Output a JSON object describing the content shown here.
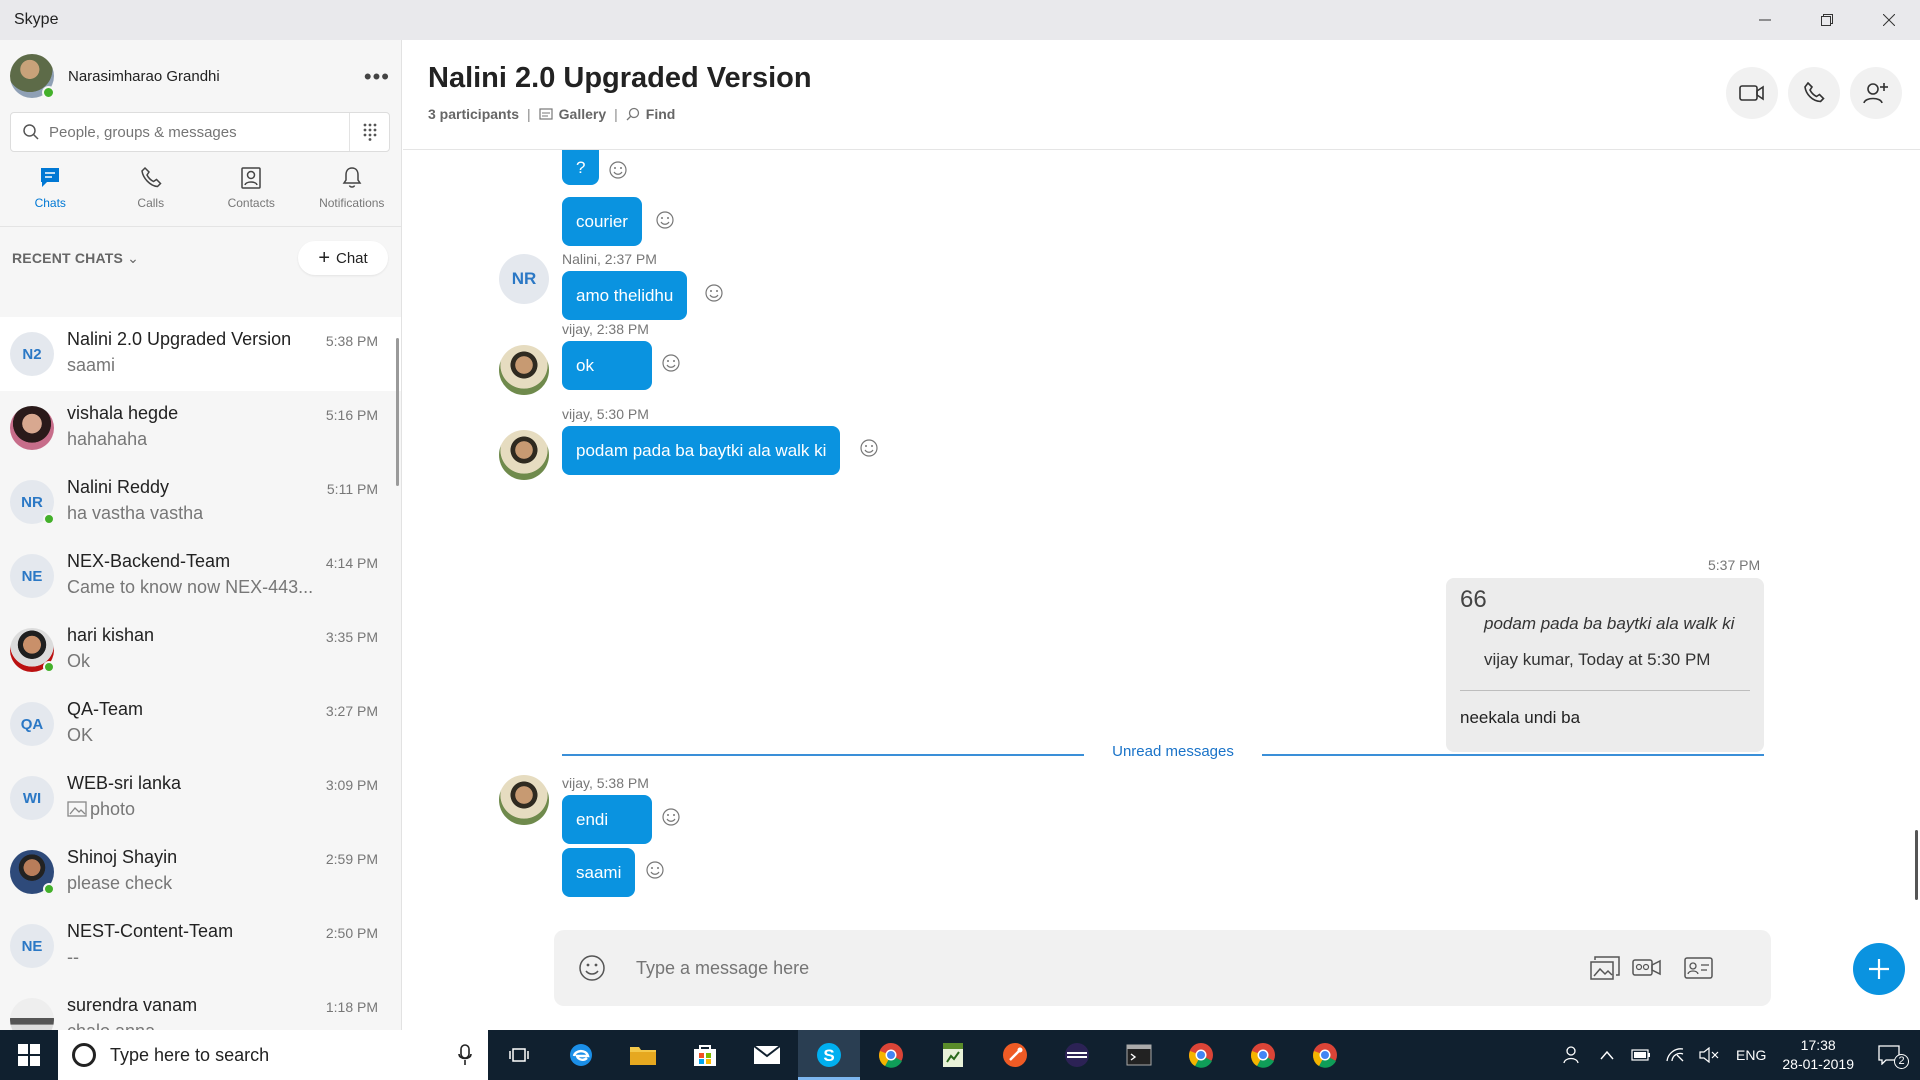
{
  "window": {
    "title": "Skype"
  },
  "profile": {
    "name": "Narasimharao Grandhi"
  },
  "search": {
    "placeholder": "People, groups & messages"
  },
  "nav": {
    "tabs": [
      {
        "label": "Chats"
      },
      {
        "label": "Calls"
      },
      {
        "label": "Contacts"
      },
      {
        "label": "Notifications"
      }
    ]
  },
  "recent": {
    "label": "RECENT CHATS",
    "new_chat_label": "Chat"
  },
  "chats": [
    {
      "title": "Nalini 2.0 Upgraded Version",
      "preview": "saami",
      "time": "5:38 PM",
      "initials": "N2",
      "online": false,
      "active": true
    },
    {
      "title": "vishala hegde",
      "preview": "hahahaha",
      "time": "5:16 PM",
      "initials": "",
      "online": false,
      "active": false
    },
    {
      "title": "Nalini Reddy",
      "preview": "ha vastha vastha",
      "time": "5:11 PM",
      "initials": "NR",
      "online": true,
      "active": false
    },
    {
      "title": "NEX-Backend-Team",
      "preview": "Came to know now NEX-443...",
      "time": "4:14 PM",
      "initials": "NE",
      "online": false,
      "active": false
    },
    {
      "title": "hari kishan",
      "preview": "Ok",
      "time": "3:35 PM",
      "initials": "",
      "online": true,
      "active": false
    },
    {
      "title": "QA-Team",
      "preview": "OK",
      "time": "3:27 PM",
      "initials": "QA",
      "online": false,
      "active": false
    },
    {
      "title": "WEB-sri lanka",
      "preview": "photo",
      "time": "3:09 PM",
      "initials": "WI",
      "online": false,
      "active": false
    },
    {
      "title": "Shinoj Shayin",
      "preview": "please check",
      "time": "2:59 PM",
      "initials": "",
      "online": true,
      "active": false
    },
    {
      "title": "NEST-Content-Team",
      "preview": "--",
      "time": "2:50 PM",
      "initials": "NE",
      "online": false,
      "active": false
    },
    {
      "title": "surendra vanam",
      "preview": "chalo anna",
      "time": "1:18 PM",
      "initials": "",
      "online": true,
      "active": false
    }
  ],
  "conversation": {
    "title": "Nalini 2.0 Upgraded Version",
    "participants": "3 participants",
    "gallery": "Gallery",
    "find": "Find",
    "messages": {
      "m1": "?",
      "m2": "courier",
      "s1": "Nalini, 2:37 PM",
      "s1_initials": "NR",
      "m3": "amo thelidhu",
      "s2": "vijay, 2:38 PM",
      "m4": "ok",
      "s3": "vijay, 5:30 PM",
      "m5": "podam pada ba baytki ala walk ki",
      "own_time": "5:37 PM",
      "quote_mark": "66",
      "quote_text": "podam pada ba baytki ala walk ki",
      "quote_author": "vijay kumar, Today at 5:30 PM",
      "own_reply": "neekala undi ba",
      "unread_label": "Unread messages",
      "s4": "vijay, 5:38 PM",
      "m6": "endi",
      "m7": "saami"
    },
    "composer_placeholder": "Type a message here"
  },
  "taskbar": {
    "search_text": "Type here to search",
    "lang": "ENG",
    "time": "17:38",
    "date": "28-01-2019",
    "notif_count": "2"
  },
  "colors": {
    "accent": "#0a93e0",
    "taskbar": "#10202f",
    "online": "#43b02a"
  }
}
